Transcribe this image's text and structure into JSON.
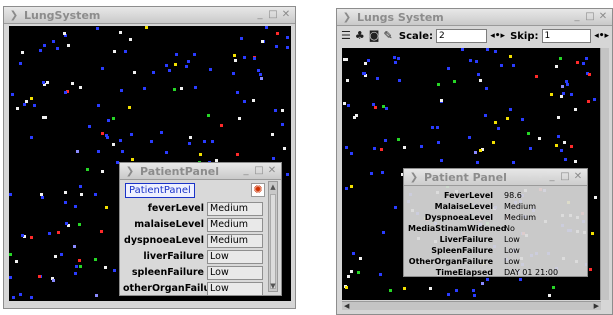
{
  "lung_window": {
    "title": "LungSystem",
    "controls": [
      "_",
      "□",
      "✕"
    ]
  },
  "system_window": {
    "title": "Lungs System",
    "controls": [
      "_",
      "□",
      "✕"
    ],
    "toolbar": {
      "scale_label": "Scale:",
      "scale_value": "2",
      "skip_label": "Skip:",
      "skip_value": "1",
      "stepper": "◂•▸"
    }
  },
  "patient_panel_left": {
    "title": "PatientPanel",
    "button_label": "PatientPanel",
    "rows": [
      {
        "label": "feverLevel",
        "value": "Medium"
      },
      {
        "label": "malaiseLevel",
        "value": "Medium"
      },
      {
        "label": "dyspnoeaLevel",
        "value": "Medium"
      },
      {
        "label": "liverFailure",
        "value": "Low"
      },
      {
        "label": "spleenFailure",
        "value": "Low"
      },
      {
        "label": "otherOrganFailure",
        "value": "Low"
      }
    ]
  },
  "patient_panel_right": {
    "title": "Patient Panel",
    "rows": [
      {
        "label": "FeverLevel",
        "value": "98.6"
      },
      {
        "label": "MalaiseLevel",
        "value": "Medium"
      },
      {
        "label": "DyspnoeaLevel",
        "value": "Medium"
      },
      {
        "label": "MediaStinamWidened",
        "value": "No"
      },
      {
        "label": "LiverFailure",
        "value": "Low"
      },
      {
        "label": "SpleenFailure",
        "value": "Low"
      },
      {
        "label": "OtherOrganFailure",
        "value": "Low"
      },
      {
        "label": "TimeElapsed",
        "value": "DAY 01   21:00"
      }
    ]
  },
  "colors": {
    "canvas_bg": "#000000",
    "cell_colors": [
      "#2a3cff",
      "#f0f0f0",
      "#ff2a2a",
      "#26d626",
      "#f2e000",
      "#8a8aff"
    ]
  }
}
